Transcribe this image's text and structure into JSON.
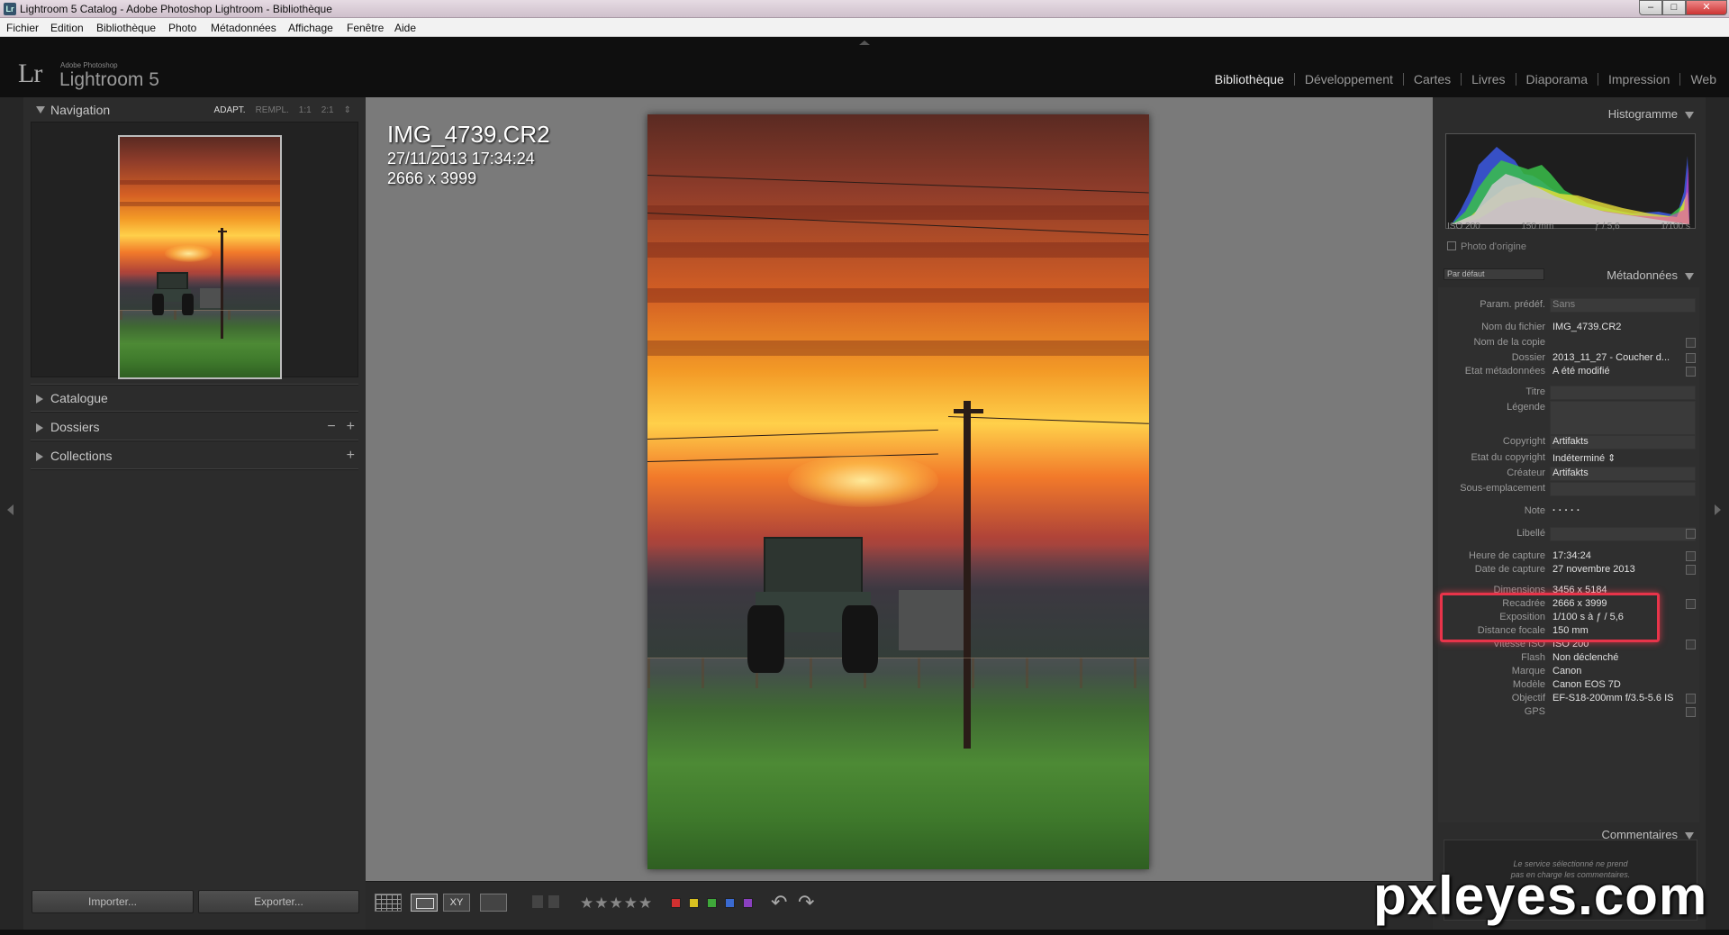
{
  "window": {
    "title": "Lightroom 5 Catalog - Adobe Photoshop Lightroom - Bibliothèque",
    "app_icon": "Lr",
    "minimize": "–",
    "maximize": "□",
    "close": "✕"
  },
  "menu": [
    "Fichier",
    "Edition",
    "Bibliothèque",
    "Photo",
    "Métadonnées",
    "Affichage",
    "Fenêtre",
    "Aide"
  ],
  "brand": {
    "logo": "Lr",
    "small": "Adobe Photoshop",
    "name": "Lightroom 5"
  },
  "modules": [
    "Bibliothèque",
    "Développement",
    "Cartes",
    "Livres",
    "Diaporama",
    "Impression",
    "Web"
  ],
  "active_module": "Bibliothèque",
  "left_panel": {
    "navigation": {
      "title": "Navigation",
      "zoom_options": [
        "ADAPT.",
        "REMPL.",
        "1:1",
        "2:1"
      ],
      "zoom_more": "⇕"
    },
    "catalogue": "Catalogue",
    "dossiers": "Dossiers",
    "dossiers_minus": "−",
    "dossiers_plus": "+",
    "collections": "Collections",
    "collections_plus": "+",
    "import_label": "Importer...",
    "export_label": "Exporter..."
  },
  "loupe_info": {
    "filename": "IMG_4739.CR2",
    "datetime": "27/11/2013 17:34:24",
    "dimensions": "2666 x 3999"
  },
  "toolbar": {
    "compare_label": "XY",
    "stars": "★★★★★",
    "color_labels": [
      "#d03030",
      "#d8c020",
      "#3fa83a",
      "#3a6ad0",
      "#8a40c0"
    ],
    "rotate_left": "↶",
    "rotate_right": "↷"
  },
  "right_panel": {
    "histogram": {
      "title": "Histogramme",
      "iso": "ISO 200",
      "focal": "150 mm",
      "aperture": "ƒ / 5,6",
      "shutter": "1/100 s",
      "original_photo": "Photo d'origine"
    },
    "metadata": {
      "title": "Métadonnées",
      "preset_select": "Par défaut",
      "rows": [
        {
          "key": "Param. prédéf.",
          "value": "Sans"
        },
        {
          "key": "Nom du fichier",
          "value": "IMG_4739.CR2"
        },
        {
          "key": "Nom de la copie",
          "value": ""
        },
        {
          "key": "Dossier",
          "value": "2013_11_27 - Coucher d..."
        },
        {
          "key": "Etat métadonnées",
          "value": "A été modifié"
        },
        {
          "key": "Titre",
          "value": ""
        },
        {
          "key": "Légende",
          "value": ""
        },
        {
          "key": "Copyright",
          "value": "Artifakts"
        },
        {
          "key": "Etat du copyright",
          "value": "Indéterminé ⇕"
        },
        {
          "key": "Créateur",
          "value": "Artifakts"
        },
        {
          "key": "Sous-emplacement",
          "value": ""
        },
        {
          "key": "Note",
          "value": "·  ·  ·  ·  ·"
        },
        {
          "key": "Libellé",
          "value": ""
        },
        {
          "key": "Heure de capture",
          "value": "17:34:24"
        },
        {
          "key": "Date de capture",
          "value": "27 novembre 2013"
        },
        {
          "key": "Dimensions",
          "value": "3456 x 5184"
        },
        {
          "key": "Recadrée",
          "value": "2666 x 3999"
        },
        {
          "key": "Exposition",
          "value": "1/100 s à ƒ / 5,6"
        },
        {
          "key": "Distance focale",
          "value": "150 mm"
        },
        {
          "key": "Vitesse ISO",
          "value": "ISO 200"
        },
        {
          "key": "Flash",
          "value": "Non déclenché"
        },
        {
          "key": "Marque",
          "value": "Canon"
        },
        {
          "key": "Modèle",
          "value": "Canon EOS 7D"
        },
        {
          "key": "Objectif",
          "value": "EF-S18-200mm f/3.5-5.6 IS"
        },
        {
          "key": "GPS",
          "value": ""
        }
      ]
    },
    "comments": {
      "title": "Commentaires",
      "message_line1": "Le service sélectionné ne prend",
      "message_line2": "pas en charge les commentaires."
    }
  },
  "watermark": "pxleyes.com"
}
